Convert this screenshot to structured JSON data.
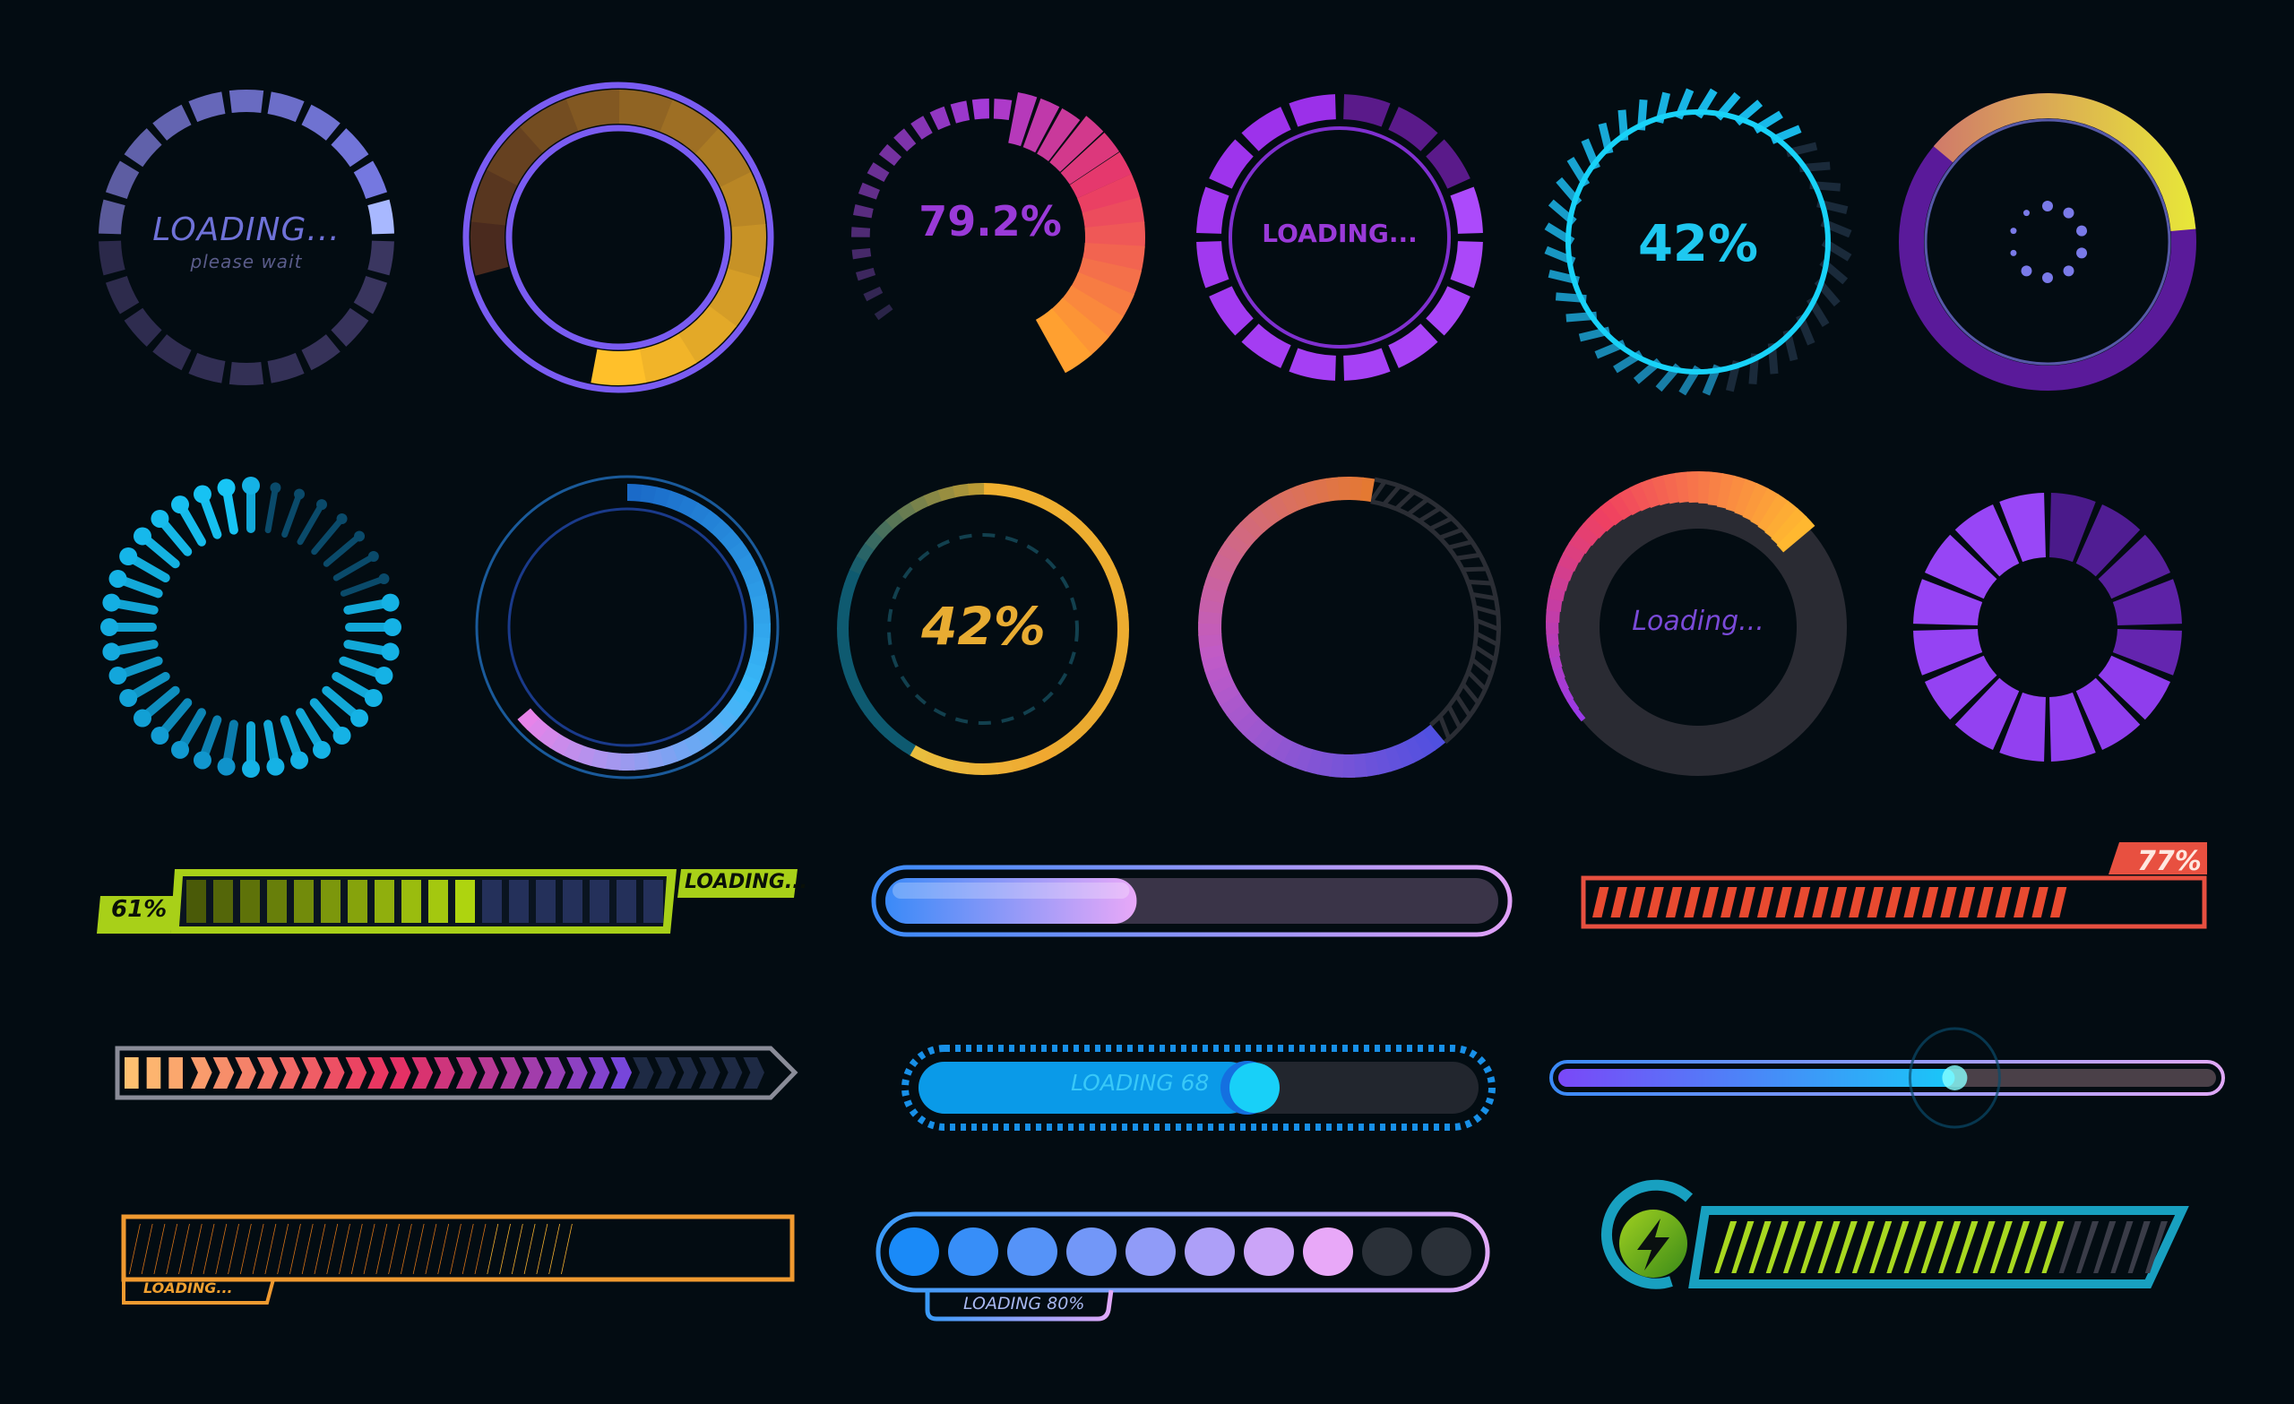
{
  "background": "#030c12",
  "spinners": [
    {
      "id": "s1",
      "label": "LOADING...",
      "sublabel": "please wait",
      "segments": 22,
      "progress": 0.42,
      "colors": {
        "active": "#7b7ff0",
        "inactive": "#3a3660",
        "text": "#6f72d8",
        "sub": "#5a5c8a"
      }
    },
    {
      "id": "s2",
      "progress": 0.82,
      "colors": {
        "ring": "#7a5cf2",
        "fill_start": "#4a2a1e",
        "fill_end": "#ffc02a"
      }
    },
    {
      "id": "s3",
      "label": "79.2%",
      "progress": 0.792,
      "segments": 30,
      "colors": {
        "start": "#2a2448",
        "mid": "#a43ad8",
        "hot": "#e83868",
        "end": "#ffa030",
        "text": "#9a3ad8"
      }
    },
    {
      "id": "s4",
      "label": "LOADING...",
      "segments": 16,
      "progress": 1.0,
      "colors": {
        "bright": "#b050ff",
        "dim": "#5a1a8a",
        "inner": "#8030d0",
        "text": "#9a3ad8"
      }
    },
    {
      "id": "s5",
      "label": "42%",
      "progress": 0.62,
      "ticks": 40,
      "colors": {
        "ring": "#18d2f8",
        "active": "#18b8e8",
        "inactive": "#1a2a3a",
        "text": "#1ec8f0"
      }
    },
    {
      "id": "s6",
      "progress": 0.32,
      "dots": 10,
      "colors": {
        "track": "#5a1a9a",
        "track_dark": "#2a0a6a",
        "fill_start": "#d07a6a",
        "fill_end": "#e8e838",
        "dot": "#7a7ae8"
      }
    },
    {
      "id": "s7",
      "rays": 36,
      "progress": 0.8,
      "colors": {
        "bright": "#18c8f8",
        "dim": "#0a4a6a"
      }
    },
    {
      "id": "s8",
      "progress": 0.62,
      "colors": {
        "outer": "#1a5a9a",
        "inner": "#1a3a8a",
        "fill_start": "#1a6ac8",
        "fill_mid": "#38b8f8",
        "fill_end": "#f080e8"
      }
    },
    {
      "id": "s9",
      "label": "42%",
      "progress": 0.38,
      "colors": {
        "track": "#0e5a70",
        "fill": "#f0a830",
        "dashes": "#12404e",
        "text": "#e8ac32"
      }
    },
    {
      "id": "s10",
      "progress": 0.63,
      "colors": {
        "start": "#e67a2c",
        "mid": "#c05ac8",
        "end": "#5050e0",
        "hatch": "#2a2d34"
      }
    },
    {
      "id": "s11",
      "label": "Loading...",
      "progress": 0.33,
      "colors": {
        "track": "#2a2b33",
        "fill_start": "#9a3ae8",
        "fill_mid": "#f04060",
        "fill_end": "#ffb830",
        "text": "#7a4ad8"
      }
    },
    {
      "id": "s12",
      "segments": 16,
      "progress": 1.0,
      "colors": {
        "bright": "#9a48f8",
        "dim": "#4a1a8a"
      }
    }
  ],
  "bars": [
    {
      "id": "b1",
      "percent_label": "61%",
      "label": "LOADING...",
      "segments": 18,
      "progress": 0.61,
      "colors": {
        "frame": "#a8d018",
        "fill_dark": "#4a5a08",
        "fill_light": "#b8e010",
        "empty": "#24305a",
        "text": "#0a1008"
      }
    },
    {
      "id": "b2",
      "progress": 0.41,
      "colors": {
        "frame_start": "#3a8af8",
        "frame_end": "#e0a0f8",
        "fill_start": "#3a8af8",
        "fill_end": "#e8a8f8",
        "track": "#3a3448"
      }
    },
    {
      "id": "b3",
      "percent_label": "77%",
      "segments": 26,
      "progress": 0.77,
      "colors": {
        "frame": "#e85040",
        "fill": "#e84a30",
        "text": "#ffe8e0"
      }
    },
    {
      "id": "b4",
      "chevrons": 29,
      "progress": 0.8,
      "colors": {
        "frame": "#8a8c98",
        "start": "#ffc070",
        "mid": "#e83060",
        "end": "#6a48e8",
        "empty": "#1e2a44"
      }
    },
    {
      "id": "b5",
      "label": "LOADING 68",
      "progress": 0.6,
      "colors": {
        "frame": "#1890e8",
        "fill": "#0a9ae8",
        "knob": "#18d0f8",
        "track": "#22262e",
        "text": "#38c8f8"
      }
    },
    {
      "id": "b6",
      "progress": 0.63,
      "colors": {
        "frame_start": "#3a8af8",
        "frame_end": "#e0a8f8",
        "fill_start": "#7a48f8",
        "fill_end": "#18c8f8",
        "track": "#4a4048",
        "glow": "#88ffff"
      }
    },
    {
      "id": "b7",
      "label": "LOADING...",
      "stripes": 36,
      "progress": 0.67,
      "colors": {
        "frame": "#f09a30",
        "fill": "#e07818",
        "bright": "#ffb830",
        "text": "#f0a030"
      }
    },
    {
      "id": "b8",
      "label": "LOADING 80%",
      "dots": 10,
      "progress": 0.8,
      "colors": {
        "frame_start": "#3a9af8",
        "frame_end": "#e0a8f8",
        "dot_start": "#1a8af8",
        "dot_end": "#e8a8f8",
        "empty": "#2a3038",
        "text": "#a8b8f0"
      }
    },
    {
      "id": "b9",
      "icon": "lightning-bolt",
      "stripes": 26,
      "progress": 0.78,
      "colors": {
        "frame": "#18a0c0",
        "fill": "#a8d820",
        "empty": "#3a3c48",
        "icon_light": "#a0d020",
        "icon_dark": "#3a8a18"
      }
    }
  ]
}
